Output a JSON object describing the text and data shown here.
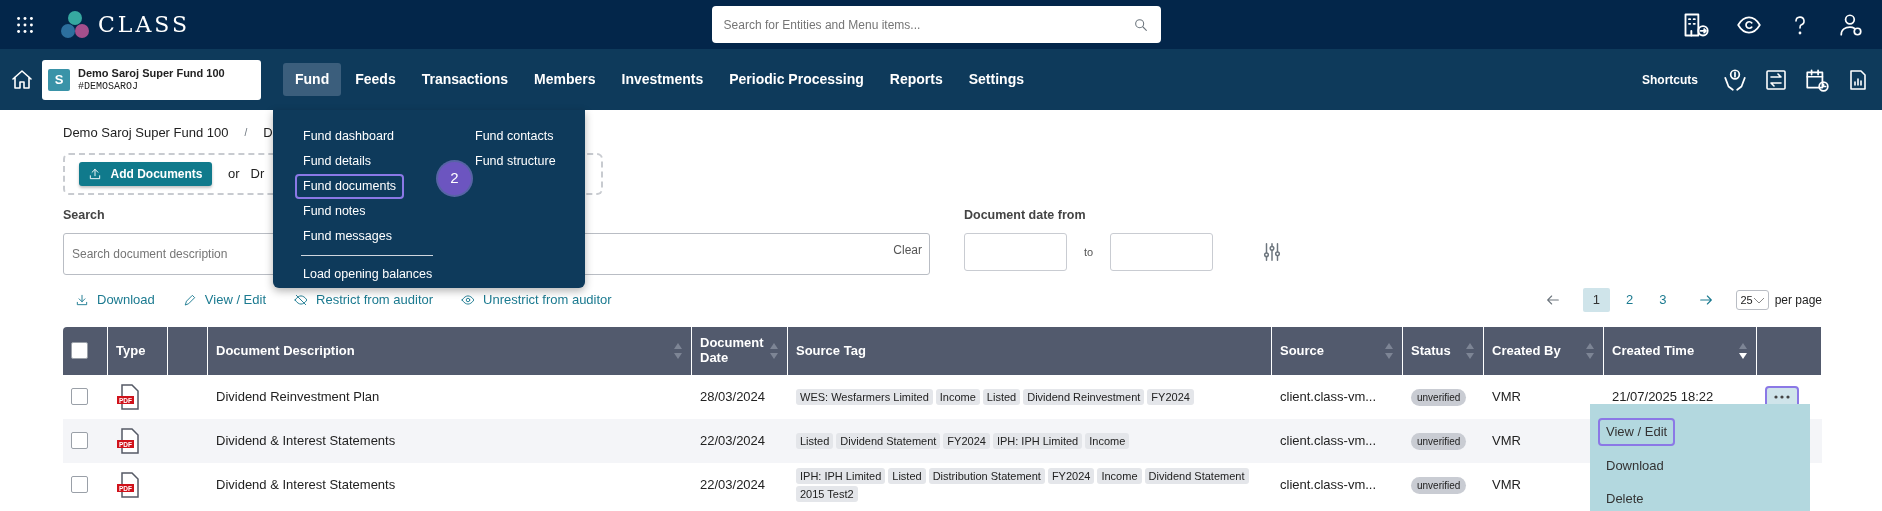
{
  "top_bar": {
    "logo": "CLASS",
    "search": {
      "placeholder": "Search for Entities and Menu items..."
    }
  },
  "fund_selector": {
    "initial": "S",
    "name": "Demo Saroj Super Fund 100",
    "code": "#DEMOSAROJ"
  },
  "nav": [
    {
      "label": "Fund",
      "selected": true
    },
    {
      "label": "Feeds",
      "selected": false
    },
    {
      "label": "Transactions",
      "selected": false
    },
    {
      "label": "Members",
      "selected": false
    },
    {
      "label": "Investments",
      "selected": false
    },
    {
      "label": "Periodic Processing",
      "selected": false
    },
    {
      "label": "Reports",
      "selected": false
    },
    {
      "label": "Settings",
      "selected": false
    }
  ],
  "shortcuts_label": "Shortcuts",
  "fund_menu": {
    "column_1": [
      {
        "label": "Fund dashboard",
        "highlighted": false
      },
      {
        "label": "Fund details",
        "highlighted": false
      },
      {
        "label": "Fund documents",
        "highlighted": true
      },
      {
        "label": "Fund notes",
        "highlighted": false
      },
      {
        "label": "Fund messages",
        "highlighted": false
      }
    ],
    "footer_item": "Load opening balances",
    "column_2": [
      {
        "label": "Fund contacts",
        "highlighted": false
      },
      {
        "label": "Fund structure",
        "highlighted": false
      }
    ],
    "callout": "2"
  },
  "breadcrumb": [
    "Demo Saroj Super Fund 100",
    "D"
  ],
  "breadcrumb_separator": "/",
  "upload": {
    "button": "Add Documents",
    "or": "or",
    "hint": "Dr"
  },
  "search": {
    "label": "Search",
    "placeholder": "Search document description",
    "clear": "Clear"
  },
  "date_filter": {
    "label": "Document date from",
    "to": "to"
  },
  "actions": [
    {
      "kind": "download",
      "label": "Download"
    },
    {
      "kind": "edit",
      "label": "View / Edit"
    },
    {
      "kind": "restrict",
      "label": "Restrict from auditor"
    },
    {
      "kind": "unrestrict",
      "label": "Unrestrict from auditor"
    }
  ],
  "pagination": {
    "pages": [
      {
        "label": "1",
        "selected": true
      },
      {
        "label": "2",
        "selected": false
      },
      {
        "label": "3",
        "selected": false
      }
    ],
    "page_size": "25",
    "per_page": "per page"
  },
  "table": {
    "header_checked": false,
    "columns": [
      {
        "kind": "checkbox"
      },
      {
        "kind": "text",
        "label": "Type"
      },
      {
        "kind": "blank"
      },
      {
        "kind": "text",
        "label": "Document Description",
        "sortable": true,
        "sorted_descending": false
      },
      {
        "kind": "text",
        "label": "Document Date",
        "sortable": true,
        "sorted_descending": false
      },
      {
        "kind": "text",
        "label": "Source Tag"
      },
      {
        "kind": "text",
        "label": "Source",
        "sortable": true,
        "sorted_descending": false
      },
      {
        "kind": "text",
        "label": "Status",
        "sortable": true,
        "sorted_descending": false
      },
      {
        "kind": "text",
        "label": "Created By",
        "sortable": true,
        "sorted_descending": false
      },
      {
        "kind": "text",
        "label": "Created Time",
        "sortable": true,
        "sorted_descending": true
      },
      {
        "kind": "blank"
      }
    ],
    "rows": [
      {
        "checked": false,
        "file_type": "PDF",
        "description": "Dividend Reinvestment Plan",
        "date": "28/03/2024",
        "tags": [
          "WES: Wesfarmers Limited",
          "Income",
          "Listed",
          "Dividend Reinvestment",
          "FY2024"
        ],
        "source": "client.class-vm...",
        "status": "unverified",
        "created_by": "VMR",
        "created_time": "21/07/2025 18:22",
        "menu_open": true
      },
      {
        "checked": false,
        "file_type": "PDF",
        "description": "Dividend & Interest Statements",
        "date": "22/03/2024",
        "tags": [
          "Listed",
          "Dividend Statement",
          "FY2024",
          "IPH: IPH Limited",
          "Income"
        ],
        "source": "client.class-vm...",
        "status": "unverified",
        "created_by": "VMR"
      },
      {
        "checked": false,
        "file_type": "PDF",
        "description": "Dividend & Interest Statements",
        "date": "22/03/2024",
        "tags": [
          "IPH: IPH Limited",
          "Listed",
          "Distribution Statement",
          "FY2024",
          "Income",
          "Dividend Statement",
          "2015 Test2"
        ],
        "source": "client.class-vm...",
        "status": "unverified",
        "created_by": "VMR"
      }
    ]
  },
  "row_menu": [
    {
      "label": "View / Edit",
      "highlighted": true
    },
    {
      "label": "Download",
      "highlighted": false
    },
    {
      "label": "Delete",
      "highlighted": false
    }
  ]
}
